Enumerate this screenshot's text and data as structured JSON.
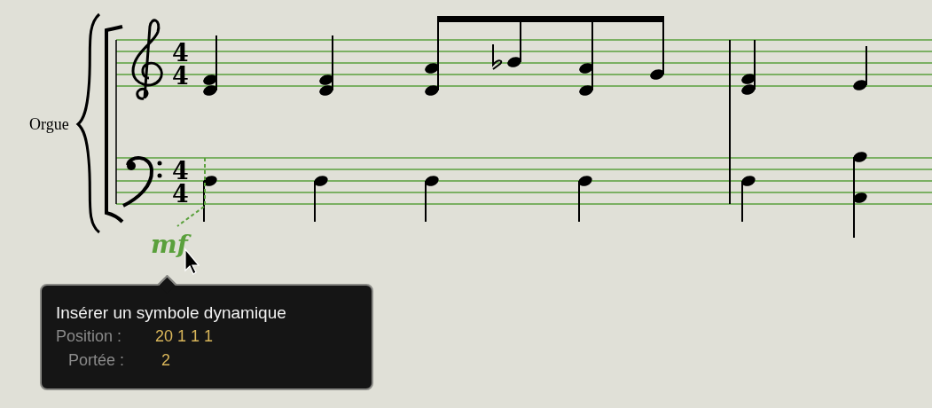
{
  "score": {
    "part_name": "Orgue",
    "staves": [
      {
        "kind": "treble",
        "time_signature": {
          "numerator": "4",
          "denominator": "4"
        }
      },
      {
        "kind": "bass",
        "time_signature": {
          "numerator": "4",
          "denominator": "4"
        }
      }
    ],
    "dynamic": {
      "text": "mf"
    }
  },
  "tooltip": {
    "title": "Insérer un symbole dynamique",
    "fields": [
      {
        "label": "Position :",
        "value": "20 1 1 1"
      },
      {
        "label": "Portée :",
        "value": "2"
      }
    ]
  }
}
